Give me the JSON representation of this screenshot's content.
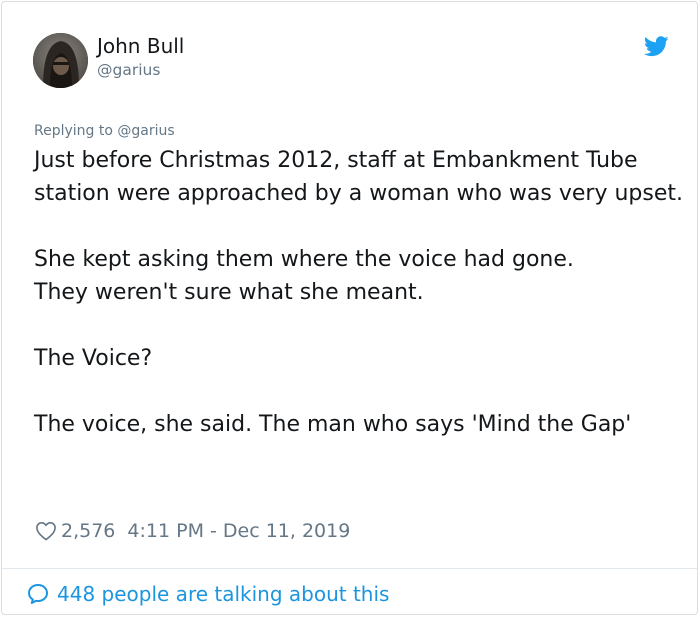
{
  "author": {
    "name": "John Bull",
    "handle": "@garius",
    "avatar_icon": "hooded-figure-avatar"
  },
  "brand": {
    "icon": "twitter-bird-icon",
    "color": "#1da1f2"
  },
  "reply": {
    "replying_to": "Replying to @garius"
  },
  "tweet": {
    "paragraphs": [
      "Just before Christmas 2012, staff at Embankment Tube station were approached by a woman who was very upset.",
      "She kept asking them where the voice had gone.\nThey weren't sure what she meant.",
      "The Voice?",
      "The voice, she said. The man who says 'Mind the Gap'"
    ]
  },
  "meta": {
    "likes": "2,576",
    "timestamp": "4:11 PM - Dec 11, 2019",
    "heart_icon": "heart-icon"
  },
  "footer": {
    "talking": "448 people are talking about this",
    "icon": "speech-bubble-icon",
    "link_color": "#1b95e0"
  }
}
